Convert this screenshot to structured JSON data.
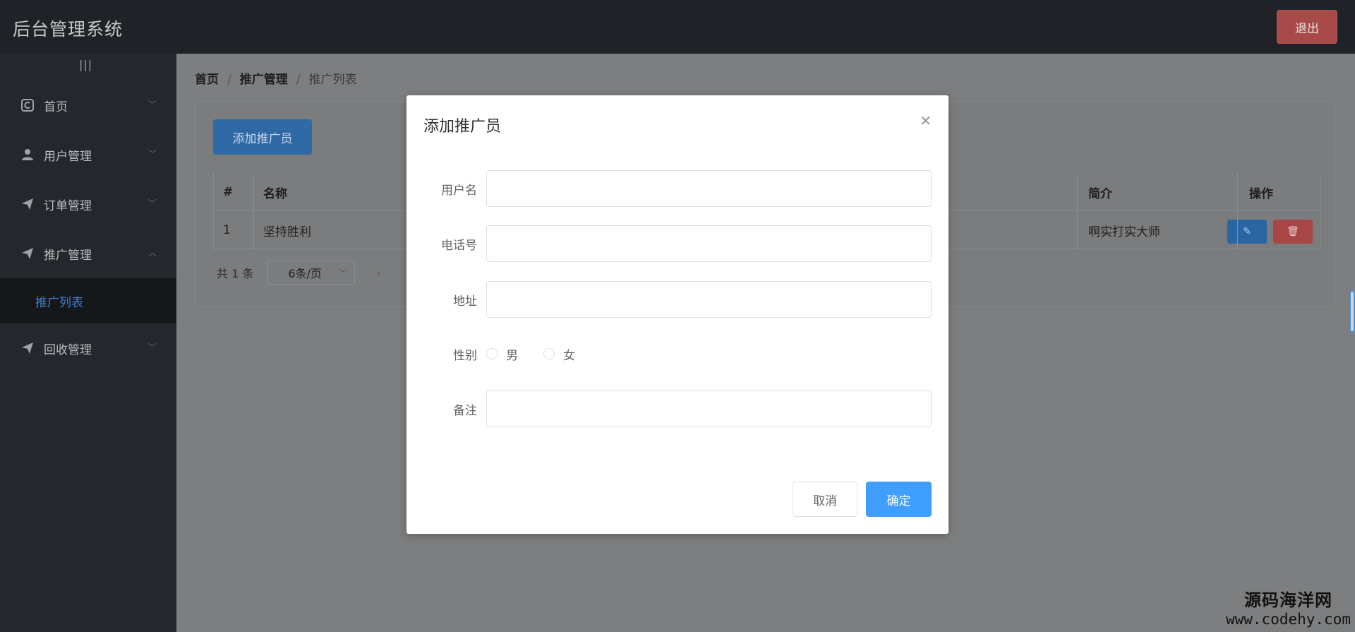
{
  "header": {
    "title": "后台管理系统",
    "logout_label": "退出"
  },
  "sidebar": {
    "toggle_icon": "|||",
    "items": [
      {
        "label": "首页",
        "icon": "dashboard-icon"
      },
      {
        "label": "用户管理",
        "icon": "user-icon"
      },
      {
        "label": "订单管理",
        "icon": "send-icon"
      },
      {
        "label": "推广管理",
        "icon": "send-icon",
        "expanded": true,
        "children": [
          {
            "label": "推广列表",
            "active": true
          }
        ]
      },
      {
        "label": "回收管理",
        "icon": "send-icon"
      }
    ]
  },
  "breadcrumb": {
    "home": "首页",
    "section": "推广管理",
    "current": "推广列表"
  },
  "toolbar": {
    "add_label": "添加推广员"
  },
  "table": {
    "headers": {
      "index": "#",
      "name": "名称",
      "intro": "简介",
      "actions": "操作"
    },
    "rows": [
      {
        "index": "1",
        "name": "坚持胜利",
        "intro": "啊实打实大师"
      }
    ]
  },
  "pager": {
    "total": "共 1 条",
    "page_size": "6条/页"
  },
  "dialog": {
    "title": "添加推广员",
    "fields": {
      "username": {
        "label": "用户名",
        "value": ""
      },
      "phone": {
        "label": "电话号",
        "value": ""
      },
      "address": {
        "label": "地址",
        "value": ""
      },
      "gender": {
        "label": "性别",
        "options": [
          "男",
          "女"
        ]
      },
      "remark": {
        "label": "备注",
        "value": ""
      }
    },
    "cancel_label": "取消",
    "ok_label": "确定"
  },
  "watermark": {
    "line1": "源码海洋网",
    "line2": "www.codehy.com"
  },
  "colors": {
    "primary": "#409eff",
    "danger": "#a84545",
    "header_bg": "#1f2226",
    "sidebar_bg": "#24272c"
  }
}
